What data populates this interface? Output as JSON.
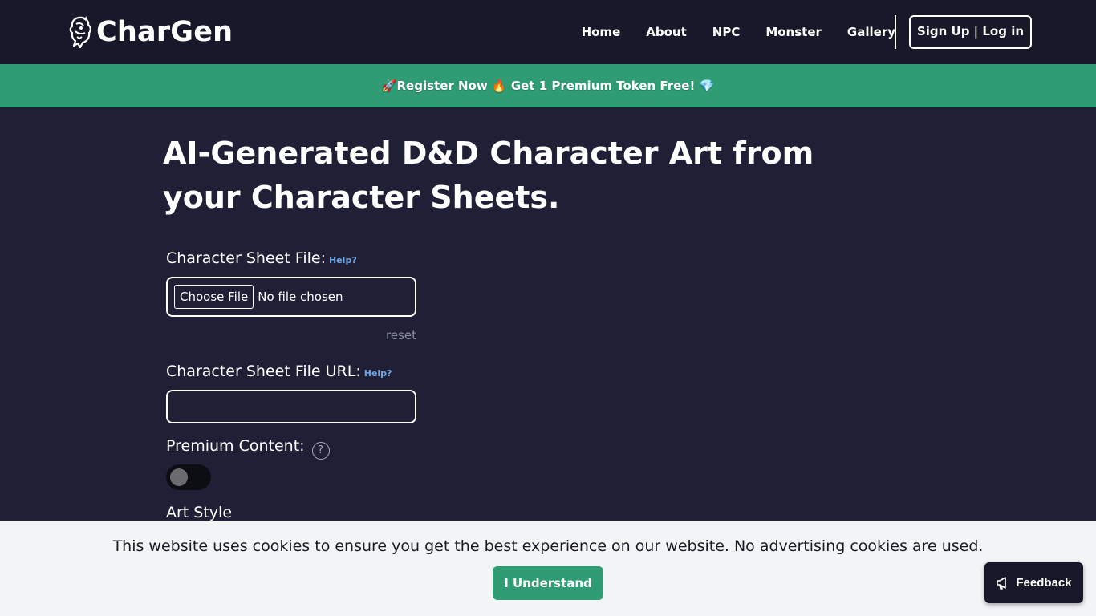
{
  "header": {
    "brand": "CharGen",
    "nav": [
      {
        "label": "Home"
      },
      {
        "label": "About"
      },
      {
        "label": "NPC"
      },
      {
        "label": "Monster"
      },
      {
        "label": "Gallery"
      }
    ],
    "signup_label": "Sign Up | Log in"
  },
  "promo": {
    "text": "🚀Register Now 🔥 Get 1 Premium Token Free! 💎"
  },
  "main": {
    "title": "AI-Generated D&D Character Art from your Character Sheets.",
    "sheet_file": {
      "label": "Character Sheet File:",
      "help": "Help?",
      "choose_label": "Choose File",
      "status": "No file chosen",
      "reset": "reset"
    },
    "sheet_url": {
      "label": "Character Sheet File URL:",
      "help": "Help?",
      "value": ""
    },
    "premium": {
      "label": "Premium Content:",
      "info_glyph": "?",
      "enabled": false
    },
    "art_style": {
      "label": "Art Style"
    }
  },
  "cookie": {
    "text": "This website uses cookies to ensure you get the best experience on our website. No advertising cookies are used.",
    "button": "I Understand"
  },
  "feedback": {
    "label": "Feedback",
    "icon": "megaphone-icon"
  },
  "colors": {
    "background": "#1f2036",
    "navbar": "#171829",
    "accent_green": "#2f9c74",
    "help_link": "#6fa6e8",
    "cookie_bg": "#f3f4f6"
  }
}
